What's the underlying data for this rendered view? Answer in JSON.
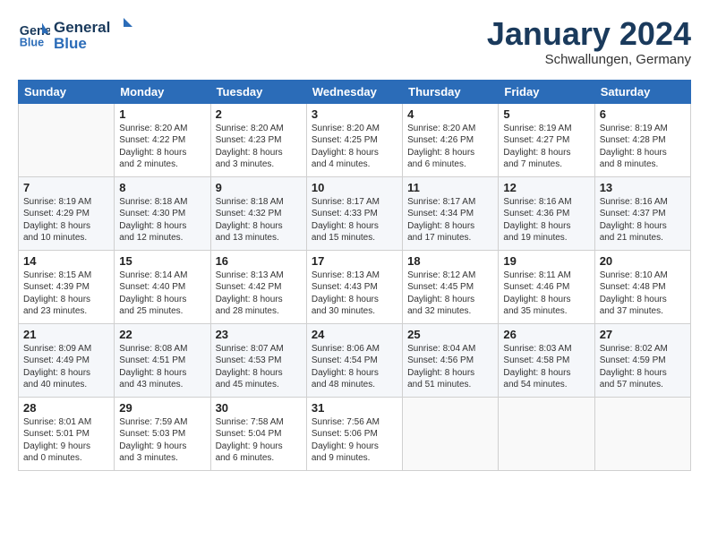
{
  "logo": {
    "line1": "General",
    "line2": "Blue"
  },
  "title": "January 2024",
  "location": "Schwallungen, Germany",
  "weekdays": [
    "Sunday",
    "Monday",
    "Tuesday",
    "Wednesday",
    "Thursday",
    "Friday",
    "Saturday"
  ],
  "weeks": [
    [
      {
        "day": "",
        "text": ""
      },
      {
        "day": "1",
        "text": "Sunrise: 8:20 AM\nSunset: 4:22 PM\nDaylight: 8 hours\nand 2 minutes."
      },
      {
        "day": "2",
        "text": "Sunrise: 8:20 AM\nSunset: 4:23 PM\nDaylight: 8 hours\nand 3 minutes."
      },
      {
        "day": "3",
        "text": "Sunrise: 8:20 AM\nSunset: 4:25 PM\nDaylight: 8 hours\nand 4 minutes."
      },
      {
        "day": "4",
        "text": "Sunrise: 8:20 AM\nSunset: 4:26 PM\nDaylight: 8 hours\nand 6 minutes."
      },
      {
        "day": "5",
        "text": "Sunrise: 8:19 AM\nSunset: 4:27 PM\nDaylight: 8 hours\nand 7 minutes."
      },
      {
        "day": "6",
        "text": "Sunrise: 8:19 AM\nSunset: 4:28 PM\nDaylight: 8 hours\nand 8 minutes."
      }
    ],
    [
      {
        "day": "7",
        "text": "Sunrise: 8:19 AM\nSunset: 4:29 PM\nDaylight: 8 hours\nand 10 minutes."
      },
      {
        "day": "8",
        "text": "Sunrise: 8:18 AM\nSunset: 4:30 PM\nDaylight: 8 hours\nand 12 minutes."
      },
      {
        "day": "9",
        "text": "Sunrise: 8:18 AM\nSunset: 4:32 PM\nDaylight: 8 hours\nand 13 minutes."
      },
      {
        "day": "10",
        "text": "Sunrise: 8:17 AM\nSunset: 4:33 PM\nDaylight: 8 hours\nand 15 minutes."
      },
      {
        "day": "11",
        "text": "Sunrise: 8:17 AM\nSunset: 4:34 PM\nDaylight: 8 hours\nand 17 minutes."
      },
      {
        "day": "12",
        "text": "Sunrise: 8:16 AM\nSunset: 4:36 PM\nDaylight: 8 hours\nand 19 minutes."
      },
      {
        "day": "13",
        "text": "Sunrise: 8:16 AM\nSunset: 4:37 PM\nDaylight: 8 hours\nand 21 minutes."
      }
    ],
    [
      {
        "day": "14",
        "text": "Sunrise: 8:15 AM\nSunset: 4:39 PM\nDaylight: 8 hours\nand 23 minutes."
      },
      {
        "day": "15",
        "text": "Sunrise: 8:14 AM\nSunset: 4:40 PM\nDaylight: 8 hours\nand 25 minutes."
      },
      {
        "day": "16",
        "text": "Sunrise: 8:13 AM\nSunset: 4:42 PM\nDaylight: 8 hours\nand 28 minutes."
      },
      {
        "day": "17",
        "text": "Sunrise: 8:13 AM\nSunset: 4:43 PM\nDaylight: 8 hours\nand 30 minutes."
      },
      {
        "day": "18",
        "text": "Sunrise: 8:12 AM\nSunset: 4:45 PM\nDaylight: 8 hours\nand 32 minutes."
      },
      {
        "day": "19",
        "text": "Sunrise: 8:11 AM\nSunset: 4:46 PM\nDaylight: 8 hours\nand 35 minutes."
      },
      {
        "day": "20",
        "text": "Sunrise: 8:10 AM\nSunset: 4:48 PM\nDaylight: 8 hours\nand 37 minutes."
      }
    ],
    [
      {
        "day": "21",
        "text": "Sunrise: 8:09 AM\nSunset: 4:49 PM\nDaylight: 8 hours\nand 40 minutes."
      },
      {
        "day": "22",
        "text": "Sunrise: 8:08 AM\nSunset: 4:51 PM\nDaylight: 8 hours\nand 43 minutes."
      },
      {
        "day": "23",
        "text": "Sunrise: 8:07 AM\nSunset: 4:53 PM\nDaylight: 8 hours\nand 45 minutes."
      },
      {
        "day": "24",
        "text": "Sunrise: 8:06 AM\nSunset: 4:54 PM\nDaylight: 8 hours\nand 48 minutes."
      },
      {
        "day": "25",
        "text": "Sunrise: 8:04 AM\nSunset: 4:56 PM\nDaylight: 8 hours\nand 51 minutes."
      },
      {
        "day": "26",
        "text": "Sunrise: 8:03 AM\nSunset: 4:58 PM\nDaylight: 8 hours\nand 54 minutes."
      },
      {
        "day": "27",
        "text": "Sunrise: 8:02 AM\nSunset: 4:59 PM\nDaylight: 8 hours\nand 57 minutes."
      }
    ],
    [
      {
        "day": "28",
        "text": "Sunrise: 8:01 AM\nSunset: 5:01 PM\nDaylight: 9 hours\nand 0 minutes."
      },
      {
        "day": "29",
        "text": "Sunrise: 7:59 AM\nSunset: 5:03 PM\nDaylight: 9 hours\nand 3 minutes."
      },
      {
        "day": "30",
        "text": "Sunrise: 7:58 AM\nSunset: 5:04 PM\nDaylight: 9 hours\nand 6 minutes."
      },
      {
        "day": "31",
        "text": "Sunrise: 7:56 AM\nSunset: 5:06 PM\nDaylight: 9 hours\nand 9 minutes."
      },
      {
        "day": "",
        "text": ""
      },
      {
        "day": "",
        "text": ""
      },
      {
        "day": "",
        "text": ""
      }
    ]
  ]
}
